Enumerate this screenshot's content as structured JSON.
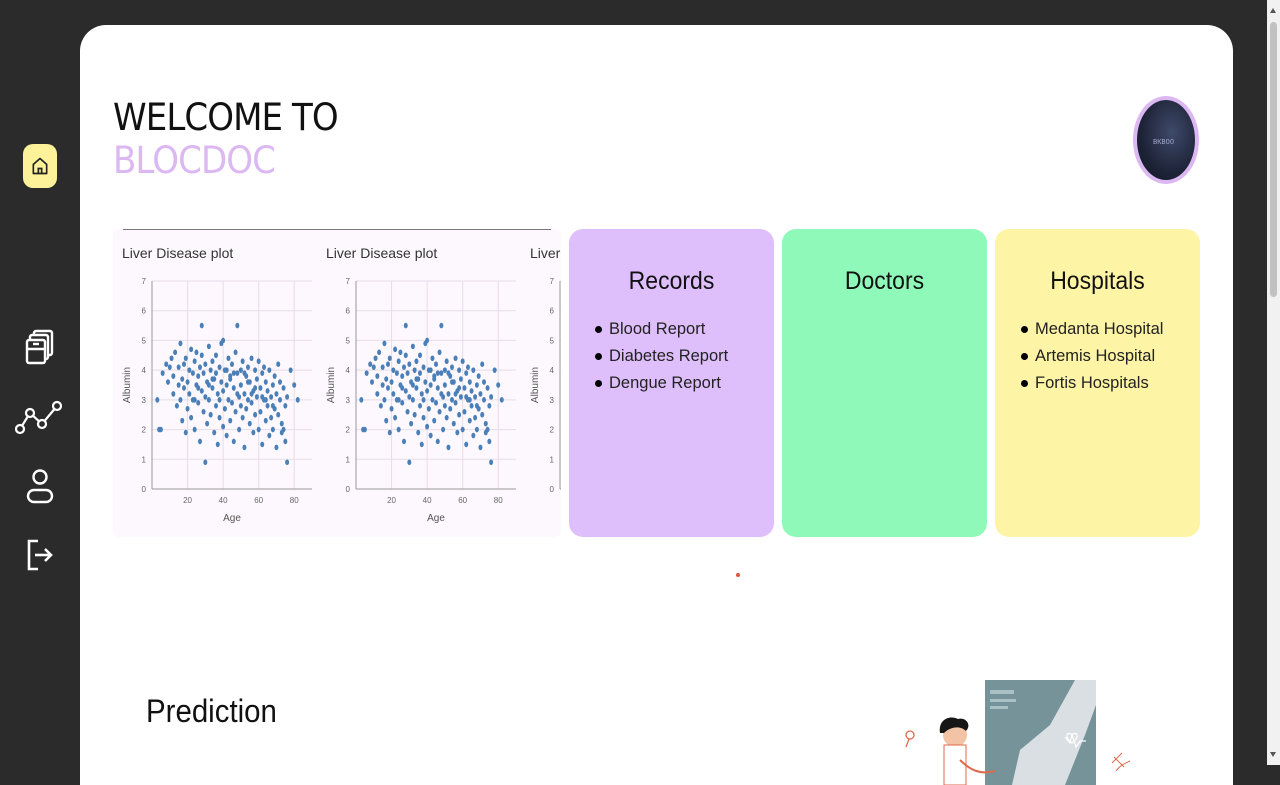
{
  "sidebar": {
    "items": [
      {
        "icon": "home-icon",
        "active": true
      },
      {
        "icon": "records-stack-icon"
      },
      {
        "icon": "analytics-graph-icon"
      },
      {
        "icon": "user-icon"
      },
      {
        "icon": "logout-icon"
      }
    ],
    "active_color": "#fdf29a"
  },
  "header": {
    "welcome": "WELCOME TO",
    "brand": "BLOCDOC",
    "brand_color": "#dcb8f3",
    "avatar_text": "BKBOO"
  },
  "carousel": {
    "plots": [
      {
        "title": "Liver Disease plot"
      },
      {
        "title": "Liver Disease plot"
      },
      {
        "title": "Liver"
      }
    ]
  },
  "chart_data": {
    "type": "scatter",
    "title": "Liver Disease plot",
    "xlabel": "Age",
    "ylabel": "Albumin",
    "xlim": [
      0,
      90
    ],
    "ylim": [
      0,
      7
    ],
    "xticks": [
      20,
      40,
      60,
      80
    ],
    "yticks": [
      0,
      1,
      2,
      3,
      4,
      5,
      6,
      7
    ],
    "color": "#4a7fb8",
    "grid": true,
    "points": [
      [
        4,
        2
      ],
      [
        5,
        2
      ],
      [
        3,
        3
      ],
      [
        6,
        3.9
      ],
      [
        8,
        4.2
      ],
      [
        9,
        3.6
      ],
      [
        10,
        4.1
      ],
      [
        11,
        4.4
      ],
      [
        12,
        3.8
      ],
      [
        12,
        3.2
      ],
      [
        13,
        4.6
      ],
      [
        14,
        2.8
      ],
      [
        15,
        4.1
      ],
      [
        15,
        3.5
      ],
      [
        16,
        4.9
      ],
      [
        16,
        3.0
      ],
      [
        17,
        3.7
      ],
      [
        17,
        2.3
      ],
      [
        18,
        4.2
      ],
      [
        18,
        3.4
      ],
      [
        19,
        1.9
      ],
      [
        19,
        4.4
      ],
      [
        20,
        3.6
      ],
      [
        20,
        2.7
      ],
      [
        21,
        4.0
      ],
      [
        21,
        3.2
      ],
      [
        22,
        4.7
      ],
      [
        22,
        2.4
      ],
      [
        23,
        3.9
      ],
      [
        23,
        3.0
      ],
      [
        24,
        4.3
      ],
      [
        24,
        2.0
      ],
      [
        25,
        3.5
      ],
      [
        25,
        4.6
      ],
      [
        26,
        2.9
      ],
      [
        26,
        3.8
      ],
      [
        27,
        4.1
      ],
      [
        27,
        1.6
      ],
      [
        28,
        3.3
      ],
      [
        28,
        4.5
      ],
      [
        28,
        5.5
      ],
      [
        29,
        2.6
      ],
      [
        29,
        3.9
      ],
      [
        30,
        3.1
      ],
      [
        30,
        4.2
      ],
      [
        30,
        0.9
      ],
      [
        31,
        2.2
      ],
      [
        31,
        3.6
      ],
      [
        32,
        4.8
      ],
      [
        32,
        3.0
      ],
      [
        33,
        2.5
      ],
      [
        33,
        4.0
      ],
      [
        34,
        3.4
      ],
      [
        34,
        4.3
      ],
      [
        35,
        1.9
      ],
      [
        35,
        3.7
      ],
      [
        36,
        2.8
      ],
      [
        36,
        4.5
      ],
      [
        37,
        3.2
      ],
      [
        37,
        1.5
      ],
      [
        38,
        4.1
      ],
      [
        38,
        2.4
      ],
      [
        39,
        3.6
      ],
      [
        39,
        4.9
      ],
      [
        40,
        2.1
      ],
      [
        40,
        3.3
      ],
      [
        40,
        5.0
      ],
      [
        41,
        4.0
      ],
      [
        41,
        2.7
      ],
      [
        42,
        3.5
      ],
      [
        42,
        1.8
      ],
      [
        43,
        4.4
      ],
      [
        43,
        3.0
      ],
      [
        44,
        2.3
      ],
      [
        44,
        3.8
      ],
      [
        45,
        4.2
      ],
      [
        45,
        2.9
      ],
      [
        46,
        3.4
      ],
      [
        46,
        1.6
      ],
      [
        47,
        4.6
      ],
      [
        47,
        2.6
      ],
      [
        48,
        3.9
      ],
      [
        48,
        5.5
      ],
      [
        49,
        3.1
      ],
      [
        49,
        2.0
      ],
      [
        50,
        4.0
      ],
      [
        50,
        3.5
      ],
      [
        51,
        2.4
      ],
      [
        51,
        4.3
      ],
      [
        52,
        3.2
      ],
      [
        52,
        1.4
      ],
      [
        53,
        3.8
      ],
      [
        53,
        2.7
      ],
      [
        54,
        4.1
      ],
      [
        54,
        3.0
      ],
      [
        55,
        2.2
      ],
      [
        55,
        3.6
      ],
      [
        56,
        4.4
      ],
      [
        56,
        2.9
      ],
      [
        57,
        3.3
      ],
      [
        57,
        1.9
      ],
      [
        58,
        4.0
      ],
      [
        58,
        2.5
      ],
      [
        59,
        3.7
      ],
      [
        59,
        3.1
      ],
      [
        60,
        2.0
      ],
      [
        60,
        4.3
      ],
      [
        61,
        3.4
      ],
      [
        61,
        2.6
      ],
      [
        62,
        3.9
      ],
      [
        62,
        1.5
      ],
      [
        63,
        3.0
      ],
      [
        63,
        4.1
      ],
      [
        64,
        2.3
      ],
      [
        64,
        3.6
      ],
      [
        65,
        2.8
      ],
      [
        65,
        3.3
      ],
      [
        66,
        1.8
      ],
      [
        66,
        4.0
      ],
      [
        67,
        3.1
      ],
      [
        67,
        2.4
      ],
      [
        68,
        3.5
      ],
      [
        68,
        2.0
      ],
      [
        69,
        3.8
      ],
      [
        69,
        2.7
      ],
      [
        70,
        3.2
      ],
      [
        70,
        1.4
      ],
      [
        71,
        4.2
      ],
      [
        71,
        2.5
      ],
      [
        72,
        3.0
      ],
      [
        72,
        3.6
      ],
      [
        73,
        2.2
      ],
      [
        73,
        1.9
      ],
      [
        74,
        3.4
      ],
      [
        74,
        2.0
      ],
      [
        75,
        2.8
      ],
      [
        75,
        1.6
      ],
      [
        76,
        3.1
      ],
      [
        76,
        0.9
      ],
      [
        78,
        4.0
      ],
      [
        80,
        3.5
      ],
      [
        82,
        3.0
      ],
      [
        36,
        3.9
      ],
      [
        44,
        3.7
      ],
      [
        52,
        3.9
      ],
      [
        58,
        3.4
      ],
      [
        26,
        3.4
      ],
      [
        34,
        3.7
      ],
      [
        42,
        4.0
      ],
      [
        48,
        3.2
      ],
      [
        54,
        3.6
      ],
      [
        62,
        3.1
      ],
      [
        68,
        2.8
      ],
      [
        24,
        3.0
      ],
      [
        32,
        3.5
      ],
      [
        46,
        3.9
      ],
      [
        56,
        3.2
      ],
      [
        64,
        3.0
      ],
      [
        38,
        3.0
      ],
      [
        50,
        2.8
      ]
    ]
  },
  "cards": [
    {
      "title": "Records",
      "color": "#dfbffb",
      "items": [
        "Blood Report",
        "Diabetes Report",
        "Dengue Report"
      ]
    },
    {
      "title": "Doctors",
      "color": "#8ef9b8",
      "items": []
    },
    {
      "title": "Hospitals",
      "color": "#fef4a6",
      "items": [
        "Medanta Hospital",
        "Artemis Hospital",
        "Fortis Hospitals"
      ]
    }
  ],
  "prediction": {
    "title": "Prediction"
  }
}
